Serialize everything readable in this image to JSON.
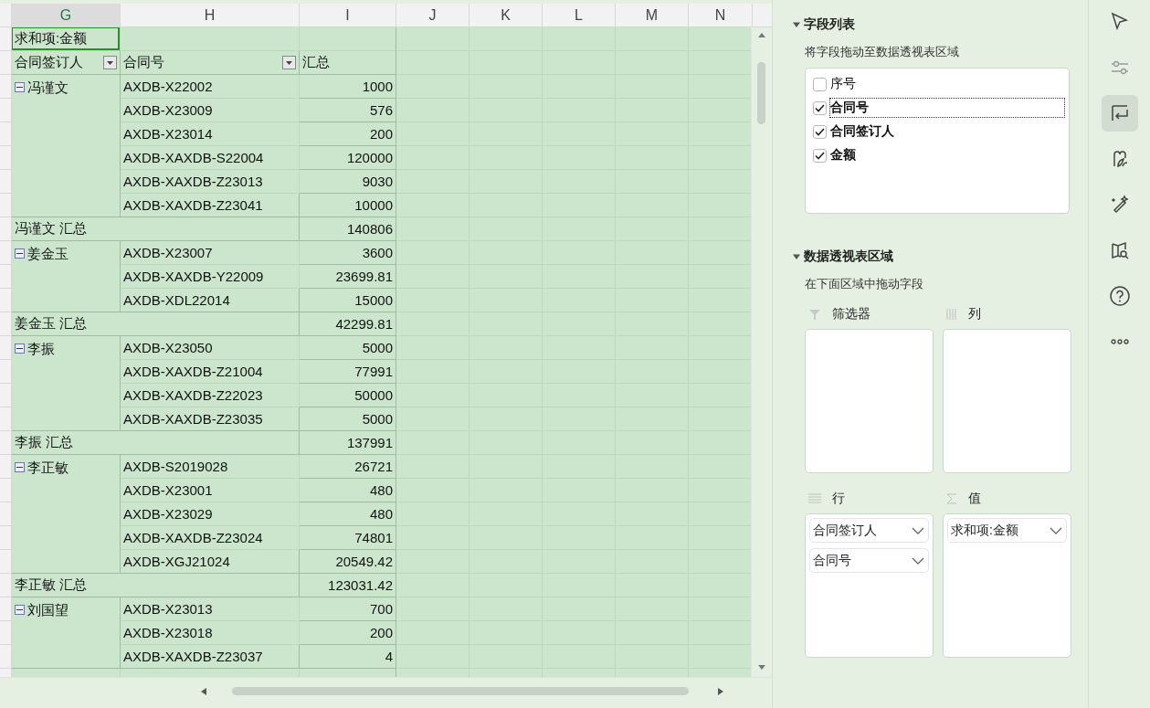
{
  "column_headers": [
    {
      "label": "G",
      "selected": true
    },
    {
      "label": "H",
      "selected": false
    },
    {
      "label": "I",
      "selected": false
    },
    {
      "label": "J",
      "selected": false
    },
    {
      "label": "K",
      "selected": false
    },
    {
      "label": "L",
      "selected": false
    },
    {
      "label": "M",
      "selected": false
    },
    {
      "label": "N",
      "selected": false
    }
  ],
  "pivot": {
    "title": "求和项:金额",
    "title_selected": true,
    "headers": [
      {
        "label": "合同签订人",
        "filter": true
      },
      {
        "label": "合同号",
        "filter": true
      },
      {
        "label": "汇总",
        "filter": false
      }
    ],
    "groups": [
      {
        "name": "冯谨文",
        "expanded": true,
        "rows": [
          {
            "contract": "AXDB-X22002",
            "amount": "1000"
          },
          {
            "contract": "AXDB-X23009",
            "amount": "576"
          },
          {
            "contract": "AXDB-X23014",
            "amount": "200"
          },
          {
            "contract": "AXDB-XAXDB-S22004",
            "amount": "120000"
          },
          {
            "contract": "AXDB-XAXDB-Z23013",
            "amount": "9030"
          },
          {
            "contract": "AXDB-XAXDB-Z23041",
            "amount": "10000"
          }
        ],
        "total_label": "冯谨文 汇总",
        "total": "140806"
      },
      {
        "name": "姜金玉",
        "expanded": true,
        "rows": [
          {
            "contract": "AXDB-X23007",
            "amount": "3600"
          },
          {
            "contract": "AXDB-XAXDB-Y22009",
            "amount": "23699.81"
          },
          {
            "contract": "AXDB-XDL22014",
            "amount": "15000"
          }
        ],
        "total_label": "姜金玉 汇总",
        "total": "42299.81"
      },
      {
        "name": "李振",
        "expanded": true,
        "rows": [
          {
            "contract": "AXDB-X23050",
            "amount": "5000"
          },
          {
            "contract": "AXDB-XAXDB-Z21004",
            "amount": "77991"
          },
          {
            "contract": "AXDB-XAXDB-Z22023",
            "amount": "50000"
          },
          {
            "contract": "AXDB-XAXDB-Z23035",
            "amount": "5000"
          }
        ],
        "total_label": "李振 汇总",
        "total": "137991"
      },
      {
        "name": "李正敏",
        "expanded": true,
        "rows": [
          {
            "contract": "AXDB-S2019028",
            "amount": "26721"
          },
          {
            "contract": "AXDB-X23001",
            "amount": "480"
          },
          {
            "contract": "AXDB-X23029",
            "amount": "480"
          },
          {
            "contract": "AXDB-XAXDB-Z23024",
            "amount": "74801"
          },
          {
            "contract": "AXDB-XGJ21024",
            "amount": "20549.42"
          }
        ],
        "total_label": "李正敏 汇总",
        "total": "123031.42"
      },
      {
        "name": "刘国望",
        "expanded": true,
        "rows": [
          {
            "contract": "AXDB-X23013",
            "amount": "700"
          },
          {
            "contract": "AXDB-X23018",
            "amount": "200"
          },
          {
            "contract": "AXDB-XAXDB-Z23037",
            "amount": "4"
          }
        ]
      }
    ]
  },
  "field_list": {
    "title": "字段列表",
    "expanded": true,
    "hint": "将字段拖动至数据透视表区域",
    "fields": [
      {
        "label": "序号",
        "checked": false,
        "focused": false
      },
      {
        "label": "合同号",
        "checked": true,
        "focused": true
      },
      {
        "label": "合同签订人",
        "checked": true,
        "focused": false
      },
      {
        "label": "金额",
        "checked": true,
        "focused": false
      }
    ]
  },
  "areas": {
    "title": "数据透视表区域",
    "expanded": true,
    "hint": "在下面区域中拖动字段",
    "zones": [
      {
        "kind": "filter",
        "label": "筛选器"
      },
      {
        "kind": "column",
        "label": "列"
      },
      {
        "kind": "row",
        "label": "行",
        "items": [
          "合同签订人",
          "合同号"
        ]
      },
      {
        "kind": "value",
        "label": "值",
        "items": [
          "求和项:金额"
        ]
      }
    ]
  },
  "rail": [
    {
      "kind": "cursor",
      "selected": false
    },
    {
      "kind": "sliders",
      "selected": false
    },
    {
      "kind": "pivot",
      "selected": true
    },
    {
      "kind": "style",
      "selected": false
    },
    {
      "kind": "magic",
      "selected": false
    },
    {
      "kind": "book",
      "selected": false
    },
    {
      "kind": "help",
      "selected": false
    },
    {
      "kind": "more",
      "selected": false
    }
  ]
}
